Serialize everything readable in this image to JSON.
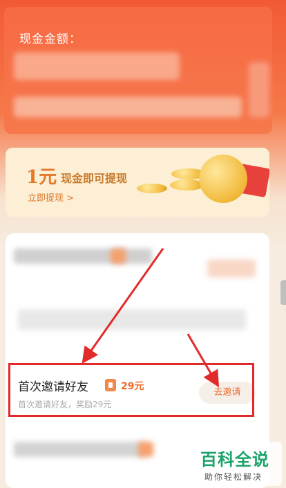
{
  "balance": {
    "label": "现金金额："
  },
  "promo": {
    "amount": "1元",
    "subtitle": "现金即可提现",
    "link": "立即提现 >"
  },
  "task": {
    "title": "首次邀请好友",
    "reward": "29元",
    "description": "首次邀请好友，奖励29元",
    "button": "去邀请"
  },
  "watermark": {
    "title": "百科全说",
    "subtitle": "助你轻松解决"
  },
  "colors": {
    "accent": "#ee6b2a",
    "highlight": "#e32a2a",
    "header": "#f25a36"
  },
  "icons": {
    "reward_badge": "coupon-icon"
  }
}
